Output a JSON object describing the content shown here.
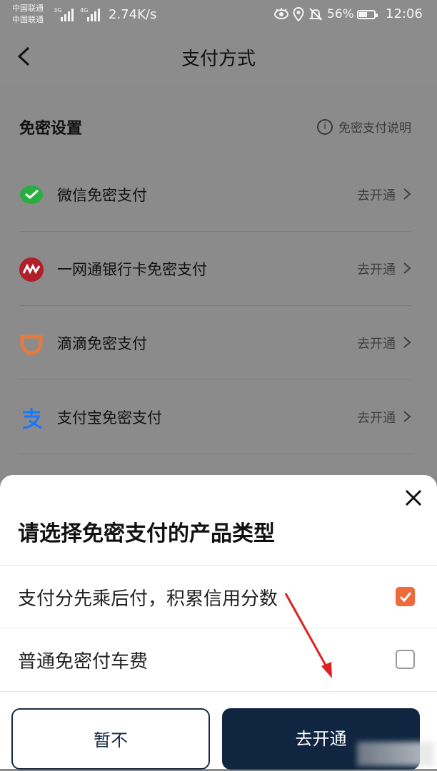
{
  "status_bar": {
    "carrier_1": "中国联通",
    "carrier_2": "中国联通",
    "net_1": "3G",
    "net_2": "4G",
    "speed": "2.74K/s",
    "battery": "56%",
    "battery_level": 0.56,
    "time": "12:06"
  },
  "header": {
    "title": "支付方式"
  },
  "section": {
    "title": "免密设置",
    "info_label": "免密支付说明",
    "items": [
      {
        "label": "微信免密支付",
        "action": "去开通",
        "icon": "wechat-pay-icon",
        "color": "#2aae3f"
      },
      {
        "label": "一网通银行卡免密支付",
        "action": "去开通",
        "icon": "cmb-yiwangtong-icon",
        "color": "#b0202a"
      },
      {
        "label": "滴滴免密支付",
        "action": "去开通",
        "icon": "didi-icon",
        "color": "#e8793a"
      },
      {
        "label": "支付宝免密支付",
        "action": "去开通",
        "icon": "alipay-icon",
        "color": "#1677ff"
      }
    ]
  },
  "sheet": {
    "title": "请选择免密支付的产品类型",
    "options": [
      {
        "label": "支付分先乘后付，积累信用分数",
        "checked": true
      },
      {
        "label": "普通免密付车费",
        "checked": false
      }
    ],
    "cancel_label": "暂不",
    "confirm_label": "去开通"
  },
  "colors": {
    "accent_orange": "#ee6a3b",
    "button_navy": "#0f2540",
    "annotation_red": "#e02020"
  }
}
